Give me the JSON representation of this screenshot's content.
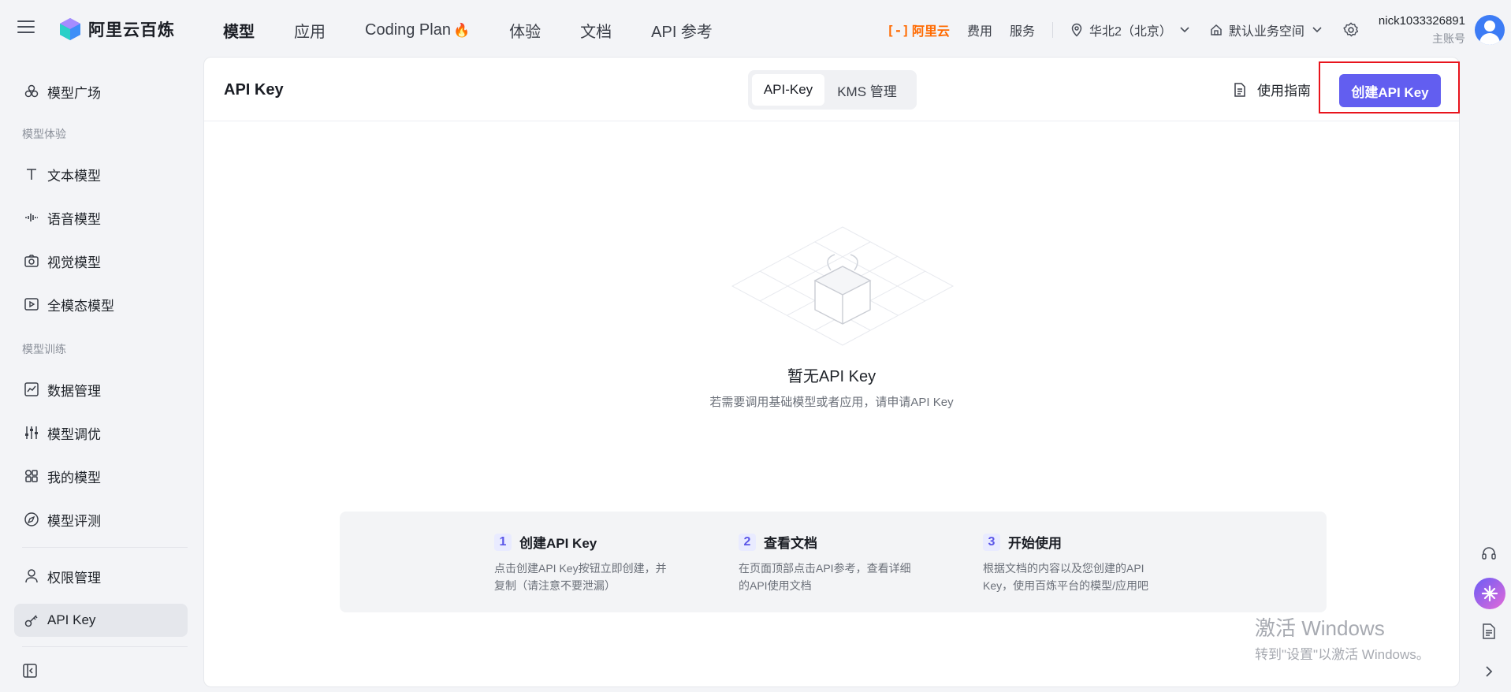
{
  "brand": {
    "name": "阿里云百炼"
  },
  "nav": {
    "items": [
      {
        "label": "模型",
        "active": true
      },
      {
        "label": "应用"
      },
      {
        "label": "Coding Plan"
      },
      {
        "label": "体验"
      },
      {
        "label": "文档"
      },
      {
        "label": "API 参考"
      }
    ],
    "flame_icon": "flame-icon"
  },
  "topright": {
    "aliyun": "阿里云",
    "fees": "费用",
    "service": "服务",
    "region": "华北2（北京）",
    "workspace": "默认业务空间",
    "user_name": "nick1033326891",
    "user_role": "主账号"
  },
  "sidebar": {
    "top_item": "模型广场",
    "group_experience": "模型体验",
    "experience_items": [
      "文本模型",
      "语音模型",
      "视觉模型",
      "全模态模型"
    ],
    "group_training": "模型训练",
    "training_items": [
      "数据管理",
      "模型调优",
      "我的模型",
      "模型评测"
    ],
    "bottom_items": [
      "权限管理",
      "API Key"
    ]
  },
  "panel": {
    "title": "API Key",
    "tabs": [
      "API-Key",
      "KMS 管理"
    ],
    "guide": "使用指南",
    "create": "创建API Key",
    "empty_title": "暂无API Key",
    "empty_sub": "若需要调用基础模型或者应用，请申请API Key",
    "steps": [
      {
        "num": "1",
        "title": "创建API Key",
        "desc1": "点击创建API Key按钮立即创建，并",
        "desc2": "复制（请注意不要泄漏）"
      },
      {
        "num": "2",
        "title": "查看文档",
        "desc1": "在页面顶部点击API参考，查看详细",
        "desc2": "的API使用文档"
      },
      {
        "num": "3",
        "title": "开始使用",
        "desc1": "根据文档的内容以及您创建的API",
        "desc2": "Key，使用百炼平台的模型/应用吧"
      }
    ]
  },
  "watermark": {
    "line1": "激活 Windows",
    "line2": "转到\"设置\"以激活 Windows。"
  },
  "colors": {
    "accent": "#625ef0",
    "aliyun": "#ff6a00",
    "highlight": "#e8141c"
  }
}
